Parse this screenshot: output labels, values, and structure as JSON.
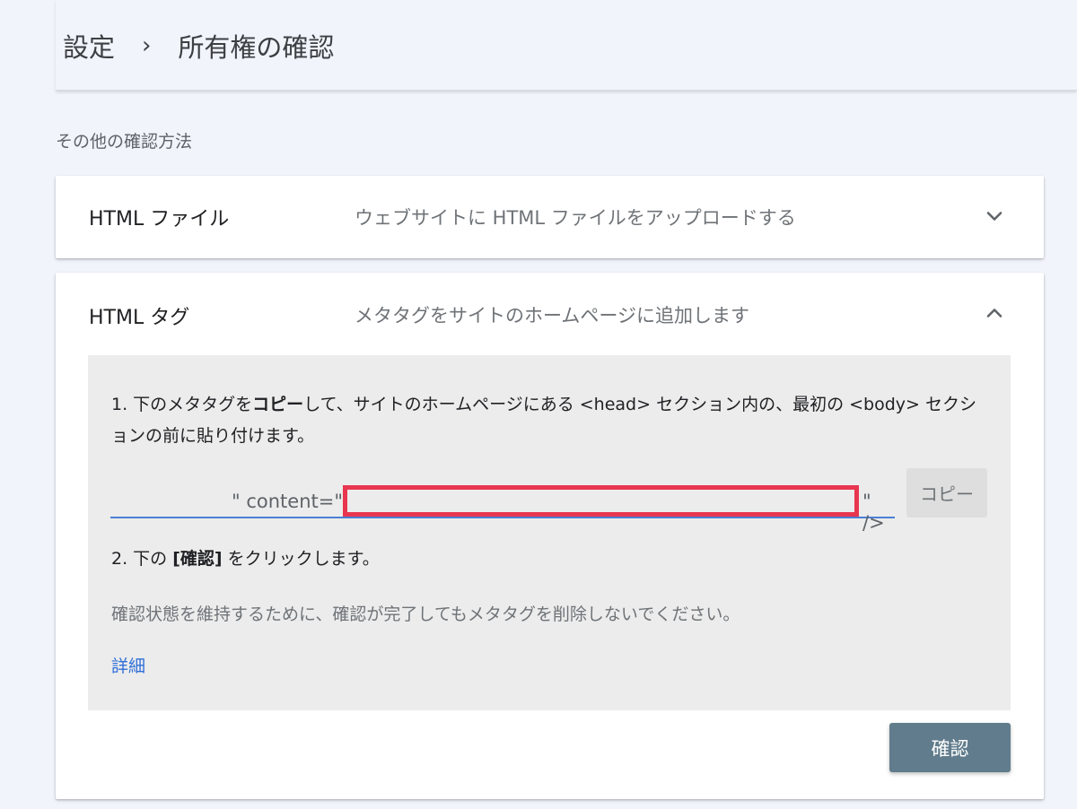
{
  "breadcrumb": {
    "parent": "設定",
    "separator": "›",
    "current": "所有権の確認"
  },
  "section": {
    "label": "その他の確認方法"
  },
  "methods": [
    {
      "title": "HTML ファイル",
      "description": "ウェブサイトに HTML ファイルをアップロードする",
      "expanded": false,
      "icon": "chevron-down-icon"
    },
    {
      "title": "HTML タグ",
      "description": "メタタグをサイトのホームページに追加します",
      "expanded": true,
      "icon": "chevron-up-icon"
    }
  ],
  "html_tag": {
    "step1": {
      "p1": "1. 下のメタタグを",
      "bold": "コピー",
      "p2": "して、サイトのホームページにある <head> セクション内の、最初の <body> セクションの前に貼り付けます。"
    },
    "meta": {
      "prefix": "\" content=\"",
      "suffix": "\" />"
    },
    "copy_label": "コピー",
    "step2": {
      "p1": "2. 下の ",
      "bold": "[確認]",
      "p2": " をクリックします。"
    },
    "note": "確認状態を維持するために、確認が完了してもメタタグを削除しないでください。",
    "detail_link": "詳細",
    "confirm_label": "確認"
  },
  "colors": {
    "background": "#f1f4fb",
    "link": "#2f6fd8",
    "input_underline": "#4a7fd6",
    "redaction_box": "#e8364f",
    "confirm_button": "#617c8c"
  }
}
